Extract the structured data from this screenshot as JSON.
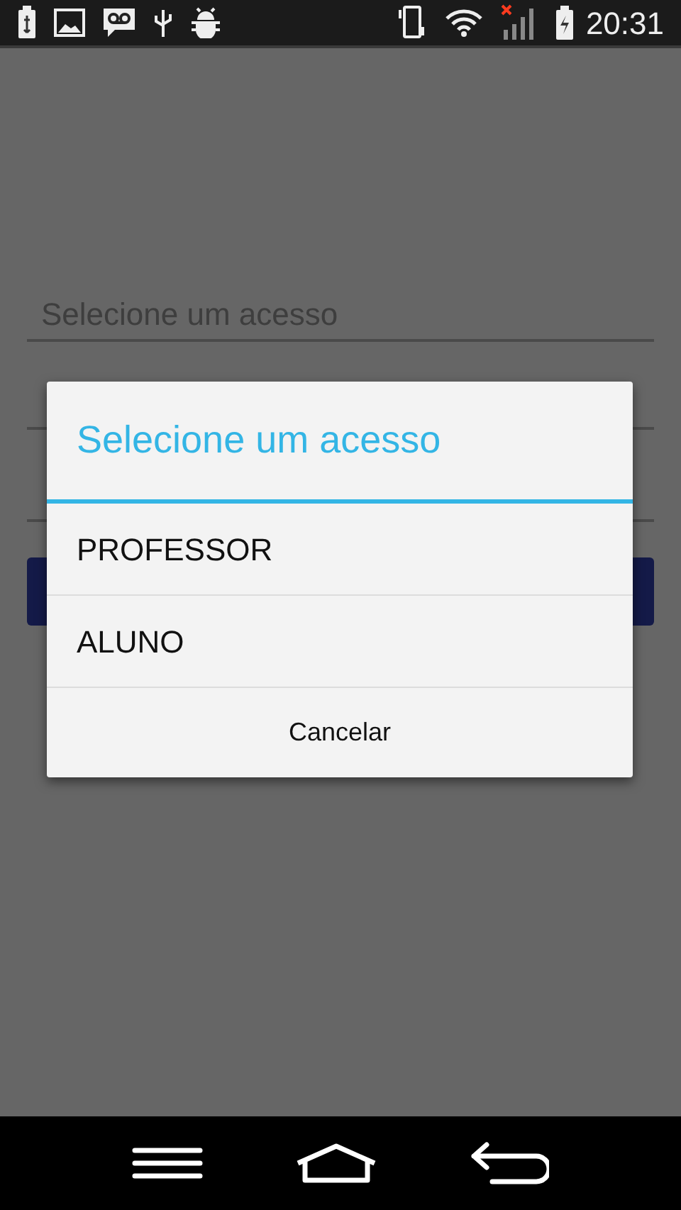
{
  "status_bar": {
    "time": "20:31"
  },
  "form": {
    "access_field": {
      "placeholder": "Selecione um acesso"
    }
  },
  "dialog": {
    "title": "Selecione um acesso",
    "options": [
      "PROFESSOR",
      "ALUNO"
    ],
    "cancel_button": "Cancelar"
  }
}
